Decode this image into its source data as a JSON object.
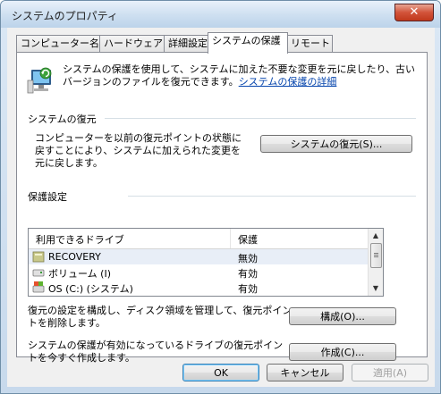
{
  "window": {
    "title": "システムのプロパティ",
    "close_label": "✕"
  },
  "tabs": [
    {
      "label": "コンピューター名"
    },
    {
      "label": "ハードウェア"
    },
    {
      "label": "詳細設定"
    },
    {
      "label": "システムの保護",
      "active": true
    },
    {
      "label": "リモート"
    }
  ],
  "intro": {
    "text": "システムの保護を使用して、システムに加えた不要な変更を元に戻したり、古いバージョンのファイルを復元できます。",
    "link": "システムの保護の詳細"
  },
  "restore": {
    "heading": "システムの復元",
    "description": "コンピューターを以前の復元ポイントの状態に戻すことにより、システムに加えられた変更を元に戻します。",
    "button": "システムの復元(S)..."
  },
  "protection": {
    "heading": "保護設定",
    "columns": [
      "利用できるドライブ",
      "保護"
    ],
    "drives": [
      {
        "name": "RECOVERY",
        "status": "無効",
        "icon": "drive-icon",
        "selected": true
      },
      {
        "name": "ボリューム (I)",
        "status": "有効",
        "icon": "removable-drive-icon"
      },
      {
        "name": "OS (C:) (システム)",
        "status": "有効",
        "icon": "system-drive-icon"
      }
    ]
  },
  "configure": {
    "description": "復元の設定を構成し、ディスク領域を管理して、復元ポイントを削除します。",
    "button": "構成(O)..."
  },
  "create": {
    "description": "システムの保護が有効になっているドライブの復元ポイントを今すぐ作成します。",
    "button": "作成(C)..."
  },
  "footer": {
    "ok": "OK",
    "cancel": "キャンセル",
    "apply": "適用(A)"
  }
}
